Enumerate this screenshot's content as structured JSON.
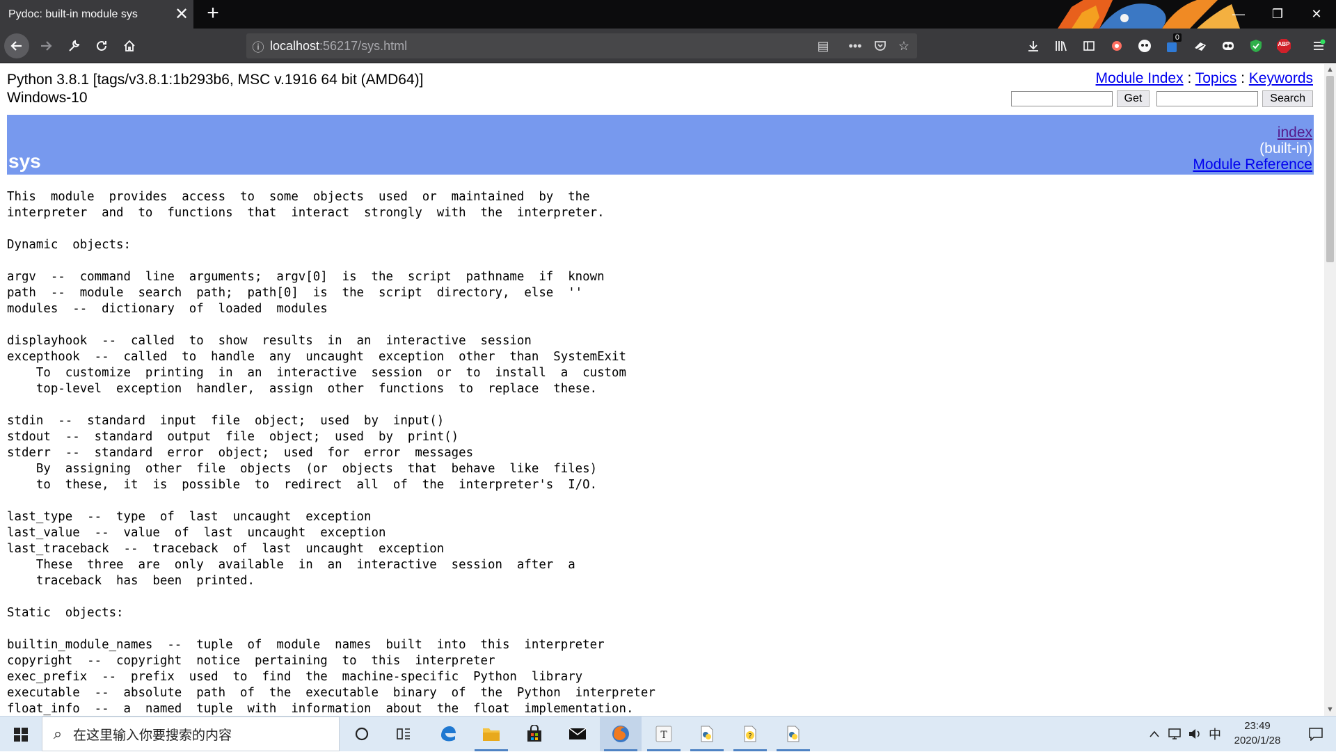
{
  "browser": {
    "tab_title": "Pydoc: built-in module sys",
    "tab_close": "✕",
    "new_tab": "+",
    "window_minimize": "—",
    "window_restore": "❐",
    "window_close": "✕",
    "url_host": "localhost",
    "url_rest": ":56217/sys.html",
    "ext_badge_count": "0",
    "abp_label": "ABP",
    "colors": {
      "tabbar": "#0c0c0d",
      "toolbar": "#3a3a3d",
      "urlbar": "#474749"
    }
  },
  "page": {
    "python_version": "Python 3.8.1 [tags/v3.8.1:1b293b6, MSC v.1916 64 bit (AMD64)]",
    "platform": "Windows-10",
    "links": {
      "module_index": "Module Index",
      "sep1": " : ",
      "topics": "Topics",
      "sep2": " : ",
      "keywords": "Keywords"
    },
    "get_button": "Get",
    "search_button": "Search",
    "banner": {
      "title": "sys",
      "index_link": "index",
      "builtin": "(built-in)",
      "module_reference": "Module Reference",
      "color": "#7799ee"
    },
    "doc_text": "This  module  provides  access  to  some  objects  used  or  maintained  by  the\ninterpreter  and  to  functions  that  interact  strongly  with  the  interpreter.\n\nDynamic  objects:\n\nargv  --  command  line  arguments;  argv[0]  is  the  script  pathname  if  known\npath  --  module  search  path;  path[0]  is  the  script  directory,  else  ''\nmodules  --  dictionary  of  loaded  modules\n\ndisplayhook  --  called  to  show  results  in  an  interactive  session\nexcepthook  --  called  to  handle  any  uncaught  exception  other  than  SystemExit\n    To  customize  printing  in  an  interactive  session  or  to  install  a  custom\n    top-level  exception  handler,  assign  other  functions  to  replace  these.\n\nstdin  --  standard  input  file  object;  used  by  input()\nstdout  --  standard  output  file  object;  used  by  print()\nstderr  --  standard  error  object;  used  for  error  messages\n    By  assigning  other  file  objects  (or  objects  that  behave  like  files)\n    to  these,  it  is  possible  to  redirect  all  of  the  interpreter's  I/O.\n\nlast_type  --  type  of  last  uncaught  exception\nlast_value  --  value  of  last  uncaught  exception\nlast_traceback  --  traceback  of  last  uncaught  exception\n    These  three  are  only  available  in  an  interactive  session  after  a\n    traceback  has  been  printed.\n\nStatic  objects:\n\nbuiltin_module_names  --  tuple  of  module  names  built  into  this  interpreter\ncopyright  --  copyright  notice  pertaining  to  this  interpreter\nexec_prefix  --  prefix  used  to  find  the  machine-specific  Python  library\nexecutable  --  absolute  path  of  the  executable  binary  of  the  Python  interpreter\nfloat_info  --  a  named  tuple  with  information  about  the  float  implementation.",
    "badge_count": "0"
  },
  "taskbar": {
    "search_placeholder": "在这里输入你要搜索的内容",
    "ime": "中",
    "time": "23:49",
    "date": "2020/1/28",
    "color": "#dde9f5"
  }
}
